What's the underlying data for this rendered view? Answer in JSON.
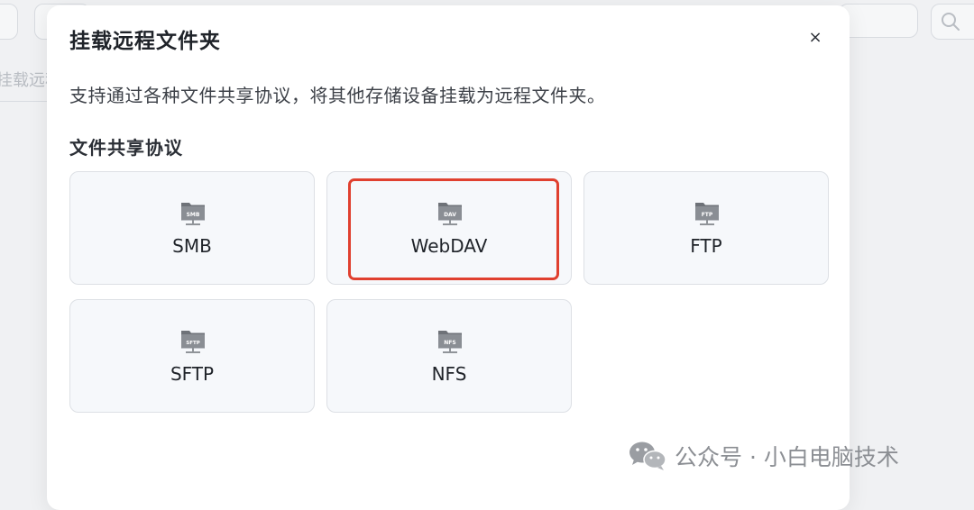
{
  "background": {
    "tab_label": "挂载远程"
  },
  "dialog": {
    "title": "挂载远程文件夹",
    "close_icon": "×",
    "description": "支持通过各种文件共享协议，将其他存储设备挂载为远程文件夹。",
    "section_label": "文件共享协议",
    "protocols": [
      {
        "label": "SMB",
        "icon": "folder-network-icon",
        "icon_badge": "SMB"
      },
      {
        "label": "WebDAV",
        "icon": "folder-network-icon",
        "icon_badge": "DAV",
        "highlighted": true
      },
      {
        "label": "FTP",
        "icon": "folder-network-icon",
        "icon_badge": "FTP"
      },
      {
        "label": "SFTP",
        "icon": "folder-network-icon",
        "icon_badge": "SFTP"
      },
      {
        "label": "NFS",
        "icon": "folder-network-icon",
        "icon_badge": "NFS"
      }
    ]
  },
  "watermark": {
    "text": "公众号 · 小白电脑技术",
    "icon": "wechat-icon"
  },
  "colors": {
    "highlight": "#e0402f",
    "card_bg": "#f6f8fb",
    "card_border": "#dde0e5"
  }
}
